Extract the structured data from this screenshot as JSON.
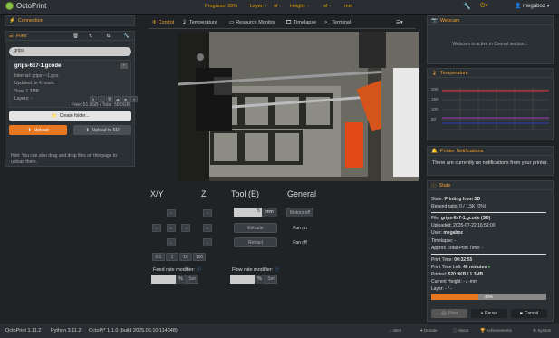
{
  "nav": {
    "brand": "OctoPrint",
    "progress_label": "Progress: 39%",
    "layer_label": "Layer: -",
    "layer_of": "of -",
    "height_label": "Height: -",
    "height_of": "of -",
    "height_unit": "mm",
    "username": "megaboz",
    "wrench_icon": "wrench-icon",
    "power_icon": "power-icon",
    "user_icon": "user-icon"
  },
  "connection": {
    "title": "Connection"
  },
  "files": {
    "title": "Files",
    "search_value": "grips",
    "file_name": "grips-6x7-1.gcode",
    "internal": "Internal: grips~~1.gco",
    "updated": "Updated: in 4 hours",
    "size": "Size: 1.3MB",
    "layers": "Layers: -",
    "free_total": "Free: 51.9GB / Total: 58.0GB",
    "create_folder": "Create folder...",
    "upload": "Upload",
    "upload_sd": "Upload to SD",
    "hint": "Hint: You can also drag and drop files on this page to upload them."
  },
  "tabs": [
    {
      "label": "Control"
    },
    {
      "label": "Temperature"
    },
    {
      "label": "Resource Monitor"
    },
    {
      "label": "Timelapse"
    },
    {
      "label": "Terminal"
    }
  ],
  "control": {
    "xy_title": "X/Y",
    "z_title": "Z",
    "tool_title": "Tool (E)",
    "general_title": "General",
    "tool_value": "5",
    "tool_unit": "mm",
    "extrude": "Extrude",
    "retract": "Retract",
    "motors_off": "Motors off",
    "fan_on": "Fan on",
    "fan_off": "Fan off",
    "steps": [
      "0.1",
      "1",
      "10",
      "100"
    ],
    "feed_label": "Feed rate modifier:",
    "feed_unit": "%",
    "feed_set": "Set",
    "flow_label": "Flow rate modifier:",
    "flow_unit": "%",
    "flow_set": "Set"
  },
  "webcam": {
    "title": "Webcam",
    "message": "Webcam is active in Control section..."
  },
  "temperature": {
    "title": "Temperature",
    "ticks": [
      "200",
      "150",
      "100",
      "50"
    ]
  },
  "notifications": {
    "title": "Printer Notifications",
    "message": "There are currently no notifications from your printer."
  },
  "state": {
    "title": "State",
    "state_label": "State:",
    "state_value": "Printing from SD",
    "resend": "Resend ratio: 0 / 1.5K (0%)",
    "file_label": "File:",
    "file_value": "grips-6x7-1.gcode (SD)",
    "uploaded": "Uploaded: 2025-07-22 16:52:00",
    "user_label": "User:",
    "user_value": "megaboz",
    "timelapse": "Timelapse: -",
    "approx": "Approx. Total Print Time: -",
    "print_time_label": "Print Time:",
    "print_time": "00:32:55",
    "time_left_label": "Print Time Left:",
    "time_left": "40 minutes",
    "printed_label": "Printed:",
    "printed": "520.9KB / 1.3MB",
    "current_height": "Current Height: - / -mm",
    "layer": "Layer: - / -",
    "progress_text": "40%",
    "progress_fraction": 0.41,
    "print_btn": "Print",
    "pause_btn": "Pause",
    "cancel_btn": "Cancel"
  },
  "footer": {
    "octoprint": "OctoPrint 1.11.2",
    "python": "Python 3.11.2",
    "os": "OctoPi* 1.1.0 (build 2025.06.10.114348)",
    "links": [
      "Web",
      "Donate",
      "About",
      "Achievements",
      "System"
    ]
  },
  "colors": {
    "accent": "#e87722",
    "bg": "#1f2326",
    "panel": "#2b3035"
  }
}
